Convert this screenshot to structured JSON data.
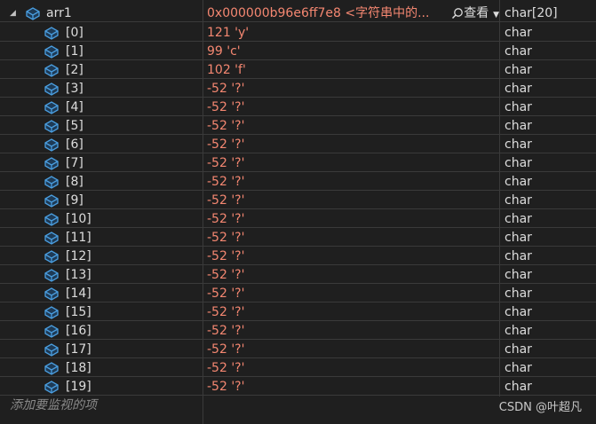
{
  "watch": {
    "root": {
      "name": "arr1",
      "value": "0x000000b96e6ff7e8  <字符串中的...",
      "viewer_label": "查看",
      "type": "char[20]",
      "expanded": true
    },
    "children": [
      {
        "name": "[0]",
        "value": "121 'y'",
        "type": "char"
      },
      {
        "name": "[1]",
        "value": "99 'c'",
        "type": "char"
      },
      {
        "name": "[2]",
        "value": "102 'f'",
        "type": "char"
      },
      {
        "name": "[3]",
        "value": "-52 '?'",
        "type": "char"
      },
      {
        "name": "[4]",
        "value": "-52 '?'",
        "type": "char"
      },
      {
        "name": "[5]",
        "value": "-52 '?'",
        "type": "char"
      },
      {
        "name": "[6]",
        "value": "-52 '?'",
        "type": "char"
      },
      {
        "name": "[7]",
        "value": "-52 '?'",
        "type": "char"
      },
      {
        "name": "[8]",
        "value": "-52 '?'",
        "type": "char"
      },
      {
        "name": "[9]",
        "value": "-52 '?'",
        "type": "char"
      },
      {
        "name": "[10]",
        "value": "-52 '?'",
        "type": "char"
      },
      {
        "name": "[11]",
        "value": "-52 '?'",
        "type": "char"
      },
      {
        "name": "[12]",
        "value": "-52 '?'",
        "type": "char"
      },
      {
        "name": "[13]",
        "value": "-52 '?'",
        "type": "char"
      },
      {
        "name": "[14]",
        "value": "-52 '?'",
        "type": "char"
      },
      {
        "name": "[15]",
        "value": "-52 '?'",
        "type": "char"
      },
      {
        "name": "[16]",
        "value": "-52 '?'",
        "type": "char"
      },
      {
        "name": "[17]",
        "value": "-52 '?'",
        "type": "char"
      },
      {
        "name": "[18]",
        "value": "-52 '?'",
        "type": "char"
      },
      {
        "name": "[19]",
        "value": "-52 '?'",
        "type": "char"
      }
    ],
    "add_item_placeholder": "添加要监视的项"
  },
  "watermark": "CSDN @叶超凡",
  "icons": {
    "expander": "expanded-triangle-icon",
    "object": "object-cube-icon",
    "viewer": "magnifier-icon",
    "dropdown": "caret-down-icon"
  },
  "colors": {
    "background": "#1f1f1f",
    "value_text": "#f48771",
    "grid_line": "#3a3a3a",
    "icon_blue": "#4a9ee0"
  }
}
